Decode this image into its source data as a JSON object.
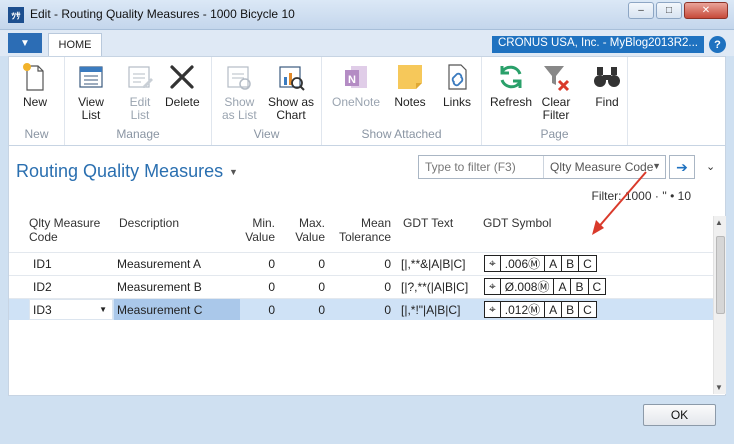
{
  "window": {
    "title": "Edit - Routing Quality Measures - 1000 Bicycle 10",
    "app_icon": "ﾂｻ",
    "minimize": "‒",
    "maximize": "□",
    "close": "✕"
  },
  "ribbon_tabs": {
    "app_menu": "▼",
    "home": "HOME"
  },
  "company": "CRONUS USA, Inc. - MyBlog2013R2...",
  "help": "?",
  "ribbon": {
    "new": {
      "buttons": {
        "new": "New"
      },
      "label": "New"
    },
    "manage": {
      "buttons": {
        "view_list": "View\nList",
        "edit_list": "Edit\nList",
        "delete": "Delete"
      },
      "label": "Manage"
    },
    "view": {
      "buttons": {
        "show_as_list": "Show\nas List",
        "show_as_chart": "Show as\nChart"
      },
      "label": "View"
    },
    "show_attached": {
      "buttons": {
        "onenote": "OneNote",
        "notes": "Notes",
        "links": "Links"
      },
      "label": "Show Attached"
    },
    "page": {
      "buttons": {
        "refresh": "Refresh",
        "clear_filter": "Clear\nFilter",
        "find": "Find"
      },
      "label": "Page"
    }
  },
  "page": {
    "title": "Routing Quality Measures",
    "title_caret": "▼",
    "filter_placeholder": "Type to filter (F3)",
    "filter_field": "Qlty Measure Code",
    "filter_text": "Filter: 1000 · '' • 10"
  },
  "grid": {
    "headers": {
      "code": "Qlty Measure\nCode",
      "description": "Description",
      "min": "Min.\nValue",
      "max": "Max.\nValue",
      "mean": "Mean\nTolerance",
      "gdt_text": "GDT Text",
      "gdt_symbol": "GDT Symbol"
    },
    "rows": [
      {
        "code": "ID1",
        "description": "Measurement A",
        "min": "0",
        "max": "0",
        "mean": "0",
        "gdt_text": "[|,**&|A|B|C]",
        "symbol": [
          "⌖",
          ".006Ⓜ",
          "A",
          "B",
          "C"
        ]
      },
      {
        "code": "ID2",
        "description": "Measurement B",
        "min": "0",
        "max": "0",
        "mean": "0",
        "gdt_text": "[|?,**(|A|B|C]",
        "symbol": [
          "⌖",
          "Ø.008Ⓜ",
          "A",
          "B",
          "C"
        ]
      },
      {
        "code": "ID3",
        "description": "Measurement C",
        "min": "0",
        "max": "0",
        "mean": "0",
        "gdt_text": "[|,*!\"|A|B|C]",
        "symbol": [
          "⌖",
          ".012Ⓜ",
          "A",
          "B",
          "C"
        ]
      }
    ]
  },
  "ok": "OK",
  "colors": {
    "accent": "#2a6fb0",
    "selection": "#cfe2f6",
    "annotation_arrow": "#d93a2b"
  }
}
